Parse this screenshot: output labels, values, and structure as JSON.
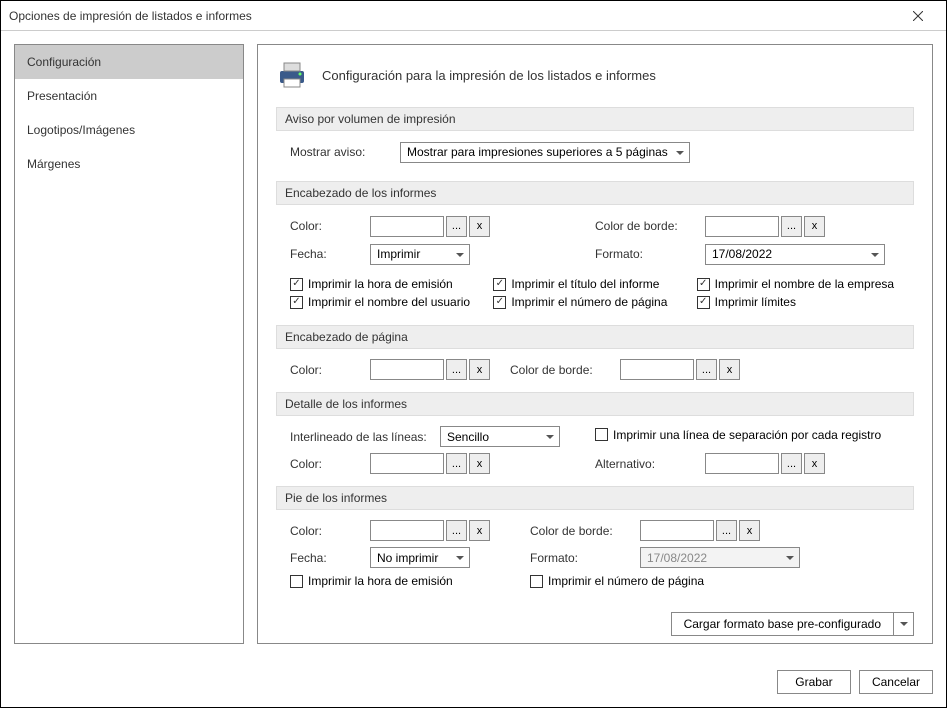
{
  "window": {
    "title": "Opciones de impresión de listados e informes"
  },
  "sidebar": {
    "items": [
      {
        "label": "Configuración",
        "active": true
      },
      {
        "label": "Presentación"
      },
      {
        "label": "Logotipos/Imágenes"
      },
      {
        "label": "Márgenes"
      }
    ]
  },
  "page": {
    "title": "Configuración para la impresión de los listados e informes"
  },
  "sections": {
    "aviso": {
      "header": "Aviso por volumen de impresión",
      "mostrar_label": "Mostrar aviso:",
      "mostrar_value": "Mostrar para impresiones superiores a 5 páginas"
    },
    "encabezado_informes": {
      "header": "Encabezado de los informes",
      "color_label": "Color:",
      "color_borde_label": "Color de borde:",
      "fecha_label": "Fecha:",
      "fecha_value": "Imprimir",
      "formato_label": "Formato:",
      "formato_value": "17/08/2022",
      "checks": {
        "hora": "Imprimir la hora de emisión",
        "titulo": "Imprimir el título del informe",
        "empresa": "Imprimir el nombre de la empresa",
        "usuario": "Imprimir el nombre del usuario",
        "numero": "Imprimir el número de página",
        "limites": "Imprimir límites"
      }
    },
    "encabezado_pagina": {
      "header": "Encabezado de página",
      "color_label": "Color:",
      "color_borde_label": "Color de borde:"
    },
    "detalle": {
      "header": "Detalle de los informes",
      "interlineado_label": "Interlineado de las líneas:",
      "interlineado_value": "Sencillo",
      "separacion_label": "Imprimir una línea de separación por cada registro",
      "color_label": "Color:",
      "alternativo_label": "Alternativo:"
    },
    "pie": {
      "header": "Pie de los informes",
      "color_label": "Color:",
      "color_borde_label": "Color de borde:",
      "fecha_label": "Fecha:",
      "fecha_value": "No imprimir",
      "formato_label": "Formato:",
      "formato_value": "17/08/2022",
      "hora_label": "Imprimir la hora de emisión",
      "numero_label": "Imprimir el número de página"
    },
    "load_button": "Cargar formato base pre-configurado"
  },
  "buttons": {
    "ellipsis": "...",
    "x": "x",
    "grabar": "Grabar",
    "cancelar": "Cancelar"
  }
}
